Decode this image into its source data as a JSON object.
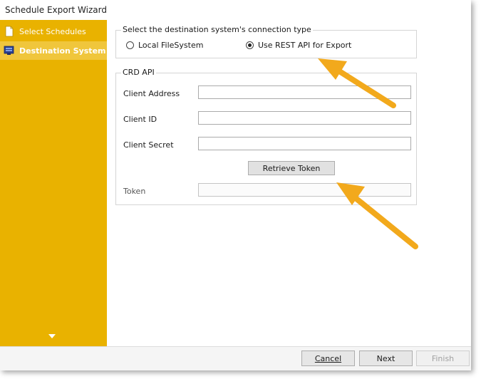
{
  "window": {
    "title": "Schedule Export Wizard"
  },
  "sidebar": {
    "items": [
      {
        "label": "Select Schedules",
        "icon": "document-icon",
        "selected": false
      },
      {
        "label": "Destination System",
        "icon": "server-icon",
        "selected": true
      }
    ],
    "bg_color": "#e9b200",
    "selected_color": "#f0c63c"
  },
  "connection_type": {
    "legend": "Select the destination system's connection type",
    "options": [
      {
        "label": "Local FileSystem",
        "selected": false
      },
      {
        "label": "Use REST API for Export",
        "selected": true
      }
    ]
  },
  "crd_api": {
    "legend": "CRD API",
    "client_address": {
      "label": "Client Address",
      "value": ""
    },
    "client_id": {
      "label": "Client ID",
      "value": ""
    },
    "client_secret": {
      "label": "Client Secret",
      "value": ""
    },
    "retrieve_token_label": "Retrieve Token",
    "token": {
      "label": "Token",
      "value": ""
    }
  },
  "footer": {
    "cancel_label": "Cancel",
    "next_label": "Next",
    "finish_label": "Finish"
  },
  "annotation": {
    "arrow_color": "#f2a91c"
  }
}
